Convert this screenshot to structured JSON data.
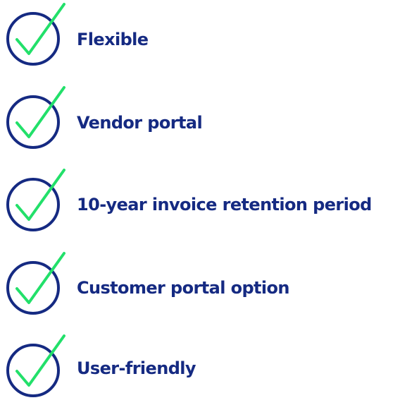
{
  "colors": {
    "text": "#152a82",
    "circle": "#152a82",
    "check": "#22e06a",
    "background": "#ffffff"
  },
  "features": [
    {
      "label": "Flexible",
      "icon": "check-circle-icon"
    },
    {
      "label": "Vendor portal",
      "icon": "check-circle-icon"
    },
    {
      "label": "10-year invoice retention period",
      "icon": "check-circle-icon"
    },
    {
      "label": "Customer portal option",
      "icon": "check-circle-icon"
    },
    {
      "label": "User-friendly",
      "icon": "check-circle-icon"
    }
  ]
}
